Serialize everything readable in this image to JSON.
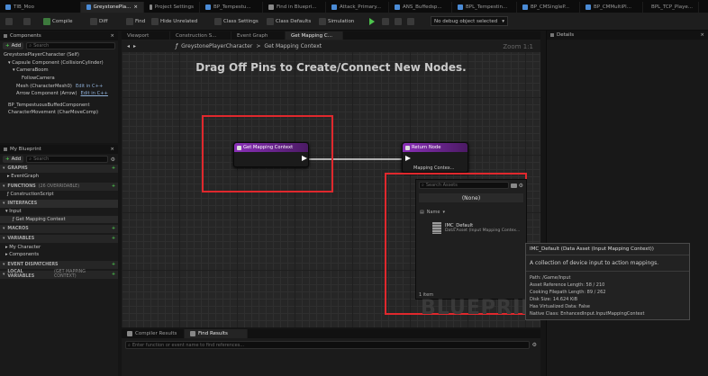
{
  "colors": {
    "accent_red": "#e0282d",
    "function_node": "#7a2aa0",
    "return_node": "#7a2aa0",
    "exec_wire": "#ffffff",
    "play_green": "#4cc34c"
  },
  "tabs": [
    {
      "label": "TIB_Moo"
    },
    {
      "label": "GreystonePla...",
      "close": "×"
    },
    {
      "label": "Project Settings"
    },
    {
      "label": "BP_Tempestu..."
    },
    {
      "label": "Find in Bluepri..."
    },
    {
      "label": "Attack_Primary..."
    },
    {
      "label": "ANS_Buffedsp..."
    },
    {
      "label": "BPL_Tempestin..."
    },
    {
      "label": "BP_CMSingleP..."
    },
    {
      "label": "BP_CMMultiPl..."
    },
    {
      "label": "BPL_TCP_Playe..."
    }
  ],
  "toolbar": {
    "compile": "Compile",
    "diff": "Diff",
    "find": "Find",
    "hide_unrelated": "Hide Unrelated",
    "class_settings": "Class Settings",
    "class_defaults": "Class Defaults",
    "simulation": "Simulation",
    "debug_object": "No debug object selected"
  },
  "components": {
    "title": "Components",
    "add": "Add",
    "search_placeholder": "Search",
    "items": [
      "GreystonePlayerCharacter (Self)",
      "Capsule Component (CollisionCylinder)",
      "CameraBoom",
      "FollowCamera",
      "Mesh (CharacterMesh0)",
      "Arrow Component (Arrow)",
      "BP_TempestuousBuffedComponent",
      "CharacterMovement (CharMoveComp)"
    ],
    "edit_links": [
      "Edit in C++",
      "Edit in C++"
    ]
  },
  "my_blueprint": {
    "title": "My Blueprint",
    "add": "Add",
    "search_placeholder": "Search",
    "sections": {
      "graphs": "GRAPHS",
      "functions": "FUNCTIONS",
      "functions_count": "(26 OVERRIDABLE)",
      "macros": "MACROS",
      "variables": "VARIABLES",
      "dispatchers": "EVENT DISPATCHERS",
      "locals": "LOCAL VARIABLES",
      "locals_suffix": "(GET MAPPING CONTEXT)"
    },
    "graph_items": [
      "EventGraph"
    ],
    "function_items": [
      "ConstructionScript"
    ],
    "interfaces_header": "INTERFACES",
    "interface_group": "Input",
    "interface_items": [
      "Get Mapping Context"
    ],
    "variable_groups": [
      "My Character",
      "Components"
    ]
  },
  "graph_tabs": {
    "viewport": "Viewport",
    "construction": "Construction S...",
    "event_graph": "Event Graph",
    "get_mapping": "Get Mapping C..."
  },
  "breadcrumb": {
    "root": "GreystonePlayerCharacter",
    "sep": ">",
    "leaf": "Get Mapping Context",
    "zoom": "Zoom 1:1"
  },
  "graph": {
    "banner": "Drag Off Pins to Create/Connect New Nodes.",
    "node_function": "Get Mapping Context",
    "node_return": "Return Node",
    "return_pin": "Mapping Contex...",
    "watermark": "BLUEPRINT"
  },
  "picker": {
    "search_placeholder": "Search Assets",
    "none": "(None)",
    "column": "Name",
    "asset_name": "IMC_Default",
    "asset_type": "Data Asset (Input Mapping Contex...",
    "count": "1 item"
  },
  "tooltip": {
    "title": "IMC_Default (Data Asset (Input Mapping Context))",
    "description": "A collection of device input to action mappings.",
    "rows": [
      "Path: /Game/Input",
      "Asset Reference Length: 58 / 210",
      "Cooking Filepath Length: 89 / 262",
      "Disk Size: 14.624 KiB",
      "Has Virtualized Data: False",
      "Native Class: EnhancedInput.InputMappingContext"
    ]
  },
  "details": {
    "title": "Details"
  },
  "bottom": {
    "compiler_results": "Compiler Results",
    "find_results": "Find Results",
    "find_placeholder": "Enter function or event name to find references..."
  }
}
